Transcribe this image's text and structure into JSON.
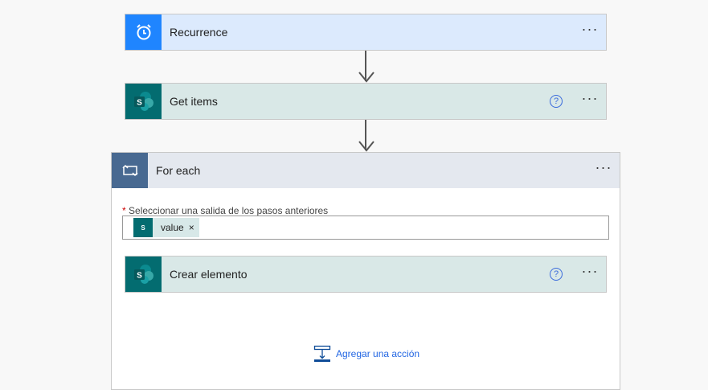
{
  "steps": [
    {
      "title": "Recurrence",
      "icon": "alarm-clock-icon",
      "color": "#1f85ff"
    },
    {
      "title": "Get items",
      "icon": "sharepoint-icon",
      "color": "#036c70"
    }
  ],
  "foreach": {
    "title": "For each",
    "field_label": "Seleccionar una salida de los pasos anteriores",
    "required_mark": "*",
    "token": "value",
    "token_remove": "×",
    "inner_step": {
      "title": "Crear elemento"
    },
    "add_action": "Agregar una acción"
  },
  "more": "···",
  "help": "?",
  "sp_letter": "S"
}
